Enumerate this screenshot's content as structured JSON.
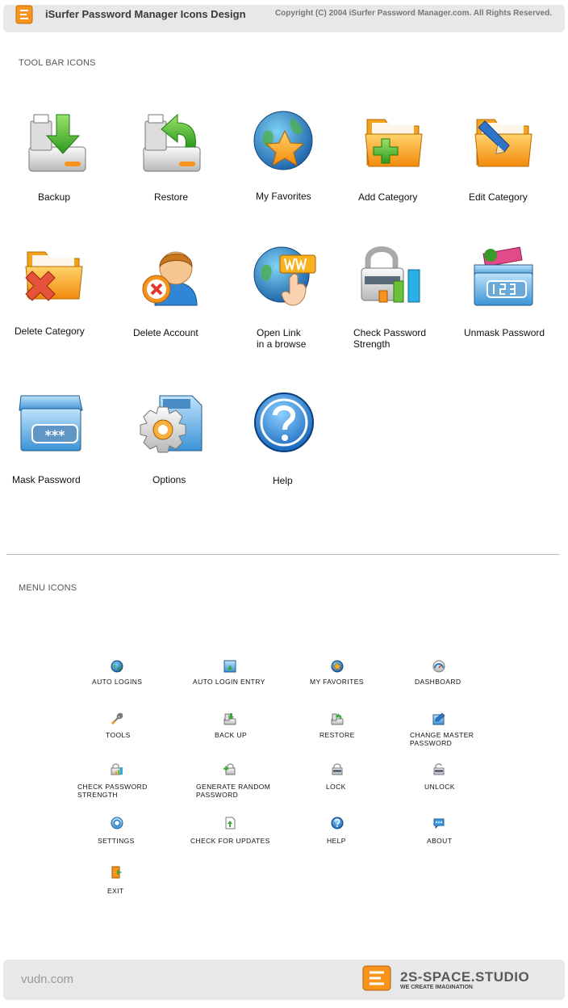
{
  "header": {
    "title": "iSurfer Password Manager Icons Design",
    "copyright": "Copyright (C) 2004 iSurfer Password Manager.com. All Rights Reserved."
  },
  "toolbar_section": {
    "title": "TOOL BAR ICONS",
    "items": [
      {
        "label": "Backup",
        "icon": "backup-icon"
      },
      {
        "label": "Restore",
        "icon": "restore-icon"
      },
      {
        "label": "My Favorites",
        "icon": "favorites-icon"
      },
      {
        "label": "Add Category",
        "icon": "add-category-icon"
      },
      {
        "label": "Edit Category",
        "icon": "edit-category-icon"
      },
      {
        "label": "Delete Category",
        "icon": "delete-category-icon"
      },
      {
        "label": "Delete Account",
        "icon": "delete-account-icon"
      },
      {
        "label": "Open Link\nin a browse",
        "icon": "open-link-icon"
      },
      {
        "label": "Check Password\nStrength",
        "icon": "check-strength-icon"
      },
      {
        "label": "Unmask Password",
        "icon": "unmask-password-icon"
      },
      {
        "label": "Mask Password",
        "icon": "mask-password-icon"
      },
      {
        "label": "Options",
        "icon": "options-icon"
      },
      {
        "label": "Help",
        "icon": "help-icon"
      }
    ]
  },
  "menu_section": {
    "title": "MENU ICONS",
    "items": [
      {
        "label": "AUTO LOGINS",
        "icon": "globe-icon"
      },
      {
        "label": "AUTO LOGIN ENTRY",
        "icon": "login-entry-icon"
      },
      {
        "label": "MY FAVORITES",
        "icon": "favorites-icon"
      },
      {
        "label": "DASHBOARD",
        "icon": "dashboard-icon"
      },
      {
        "label": "TOOLS",
        "icon": "wrench-icon"
      },
      {
        "label": "BACK UP",
        "icon": "backup-icon"
      },
      {
        "label": "RESTORE",
        "icon": "restore-icon"
      },
      {
        "label": "CHANGE MASTER\nPASSWORD",
        "icon": "change-password-icon"
      },
      {
        "label": "CHECK PASSWORD\nSTRENGTH",
        "icon": "check-strength-icon"
      },
      {
        "label": "GENERATE RANDOM\nPASSWORD",
        "icon": "generate-password-icon"
      },
      {
        "label": "LOCK",
        "icon": "lock-icon"
      },
      {
        "label": "UNLOCK",
        "icon": "unlock-icon"
      },
      {
        "label": "SETTINGS",
        "icon": "settings-icon"
      },
      {
        "label": "CHECK FOR UPDATES",
        "icon": "updates-icon"
      },
      {
        "label": "HELP",
        "icon": "help-icon"
      },
      {
        "label": "ABOUT",
        "icon": "about-icon"
      },
      {
        "label": "EXIT",
        "icon": "exit-icon"
      }
    ]
  },
  "footer": {
    "site": "vudn.com",
    "brand": "2S-SPACE.STUDIO",
    "tagline": "WE CREATE IMAGINATION"
  },
  "colors": {
    "orange": "#f7941d",
    "green": "#3aa935",
    "blue": "#2a7fc9",
    "gray": "#e8e8e8"
  }
}
